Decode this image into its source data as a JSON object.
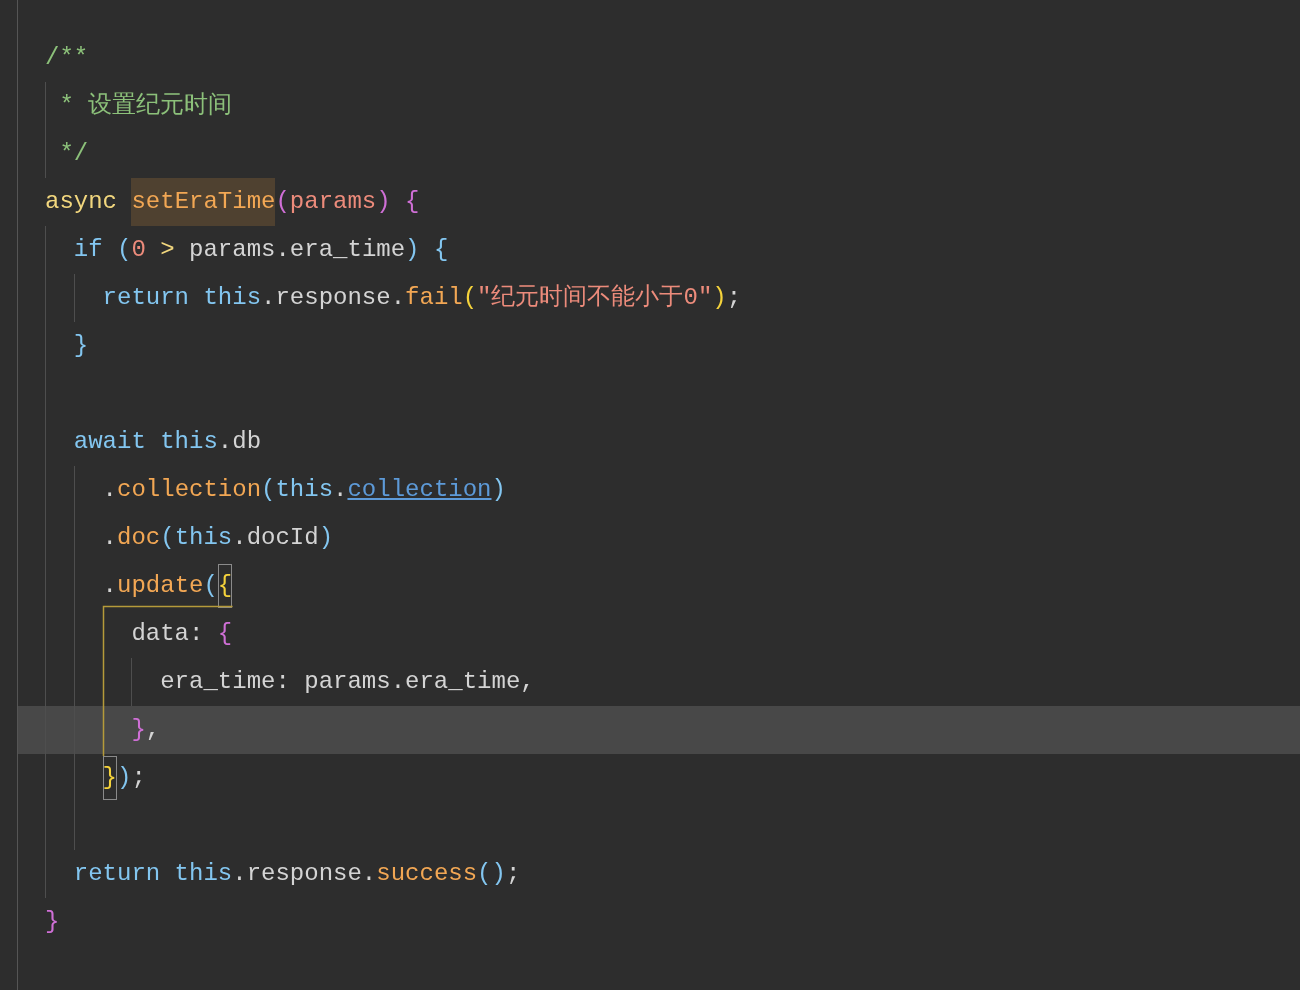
{
  "editor": {
    "lines": [
      {
        "current": false,
        "tokens": [
          {
            "text": "/**",
            "kind": "comment"
          }
        ]
      },
      {
        "current": false,
        "tokens": [
          {
            "text": " * 设置纪元时间",
            "kind": "comment"
          }
        ]
      },
      {
        "current": false,
        "tokens": [
          {
            "text": " */",
            "kind": "comment"
          }
        ]
      },
      {
        "current": false,
        "tokens": [
          {
            "text": "async ",
            "kind": "storage"
          },
          {
            "text": "setEraTime",
            "kind": "function_highlight"
          },
          {
            "text": "(",
            "kind": "brace1"
          },
          {
            "text": "params",
            "kind": "param"
          },
          {
            "text": ") {",
            "kind": "brace1"
          }
        ]
      },
      {
        "current": false,
        "tokens": [
          {
            "text": "  if ",
            "kind": "keyword"
          },
          {
            "text": "(",
            "kind": "brace2"
          },
          {
            "text": "0 ",
            "kind": "number"
          },
          {
            "text": "> ",
            "kind": "operator"
          },
          {
            "text": "params.era_time",
            "kind": "text"
          },
          {
            "text": ") {",
            "kind": "brace2"
          }
        ]
      },
      {
        "current": false,
        "tokens": [
          {
            "text": "    return this",
            "kind": "keyword"
          },
          {
            "text": ".response.",
            "kind": "text"
          },
          {
            "text": "fail",
            "kind": "function"
          },
          {
            "text": "(",
            "kind": "brace3"
          },
          {
            "text": "\"纪元时间不能小于0\"",
            "kind": "string"
          },
          {
            "text": ")",
            "kind": "brace3"
          },
          {
            "text": ";",
            "kind": "text"
          }
        ]
      },
      {
        "current": false,
        "tokens": [
          {
            "text": "  }",
            "kind": "brace2"
          }
        ]
      },
      {
        "current": false
      },
      {
        "current": false,
        "tokens": [
          {
            "text": "  await this",
            "kind": "keyword"
          },
          {
            "text": ".db",
            "kind": "text"
          }
        ]
      },
      {
        "current": false,
        "tokens": [
          {
            "text": "    .",
            "kind": "text"
          },
          {
            "text": "collection",
            "kind": "function"
          },
          {
            "text": "(",
            "kind": "brace2"
          },
          {
            "text": "this",
            "kind": "keyword"
          },
          {
            "text": ".",
            "kind": "text"
          },
          {
            "text": "collection",
            "kind": "link"
          },
          {
            "text": ")",
            "kind": "brace2"
          }
        ]
      },
      {
        "current": false,
        "tokens": [
          {
            "text": "    .",
            "kind": "text"
          },
          {
            "text": "doc",
            "kind": "function"
          },
          {
            "text": "(",
            "kind": "brace2"
          },
          {
            "text": "this",
            "kind": "keyword"
          },
          {
            "text": ".docId",
            "kind": "text"
          },
          {
            "text": ")",
            "kind": "brace2"
          }
        ]
      },
      {
        "current": false,
        "tokens": [
          {
            "text": "    .",
            "kind": "text"
          },
          {
            "text": "update",
            "kind": "function"
          },
          {
            "text": "(",
            "kind": "brace2"
          },
          {
            "text": "{",
            "kind": "bracket_match"
          }
        ]
      },
      {
        "current": false,
        "tokens": [
          {
            "text": "      data: ",
            "kind": "text"
          },
          {
            "text": "{",
            "kind": "brace1"
          }
        ]
      },
      {
        "current": false,
        "tokens": [
          {
            "text": "        era_time: params.era_time,",
            "kind": "text"
          }
        ]
      },
      {
        "current": true,
        "tokens": [
          {
            "text": "      }",
            "kind": "brace1"
          },
          {
            "text": ",",
            "kind": "text"
          }
        ]
      },
      {
        "current": false,
        "tokens": [
          {
            "text": "    }",
            "kind": "bracket_match"
          },
          {
            "text": ")",
            "kind": "brace2"
          },
          {
            "text": ";",
            "kind": "text"
          }
        ]
      },
      {
        "current": false
      },
      {
        "current": false,
        "tokens": [
          {
            "text": "  return this",
            "kind": "keyword"
          },
          {
            "text": ".response.",
            "kind": "text"
          },
          {
            "text": "success",
            "kind": "function"
          },
          {
            "text": "()",
            "kind": "brace2"
          },
          {
            "text": ";",
            "kind": "text"
          }
        ]
      },
      {
        "current": false,
        "tokens": [
          {
            "text": "}",
            "kind": "brace1"
          }
        ]
      }
    ]
  }
}
